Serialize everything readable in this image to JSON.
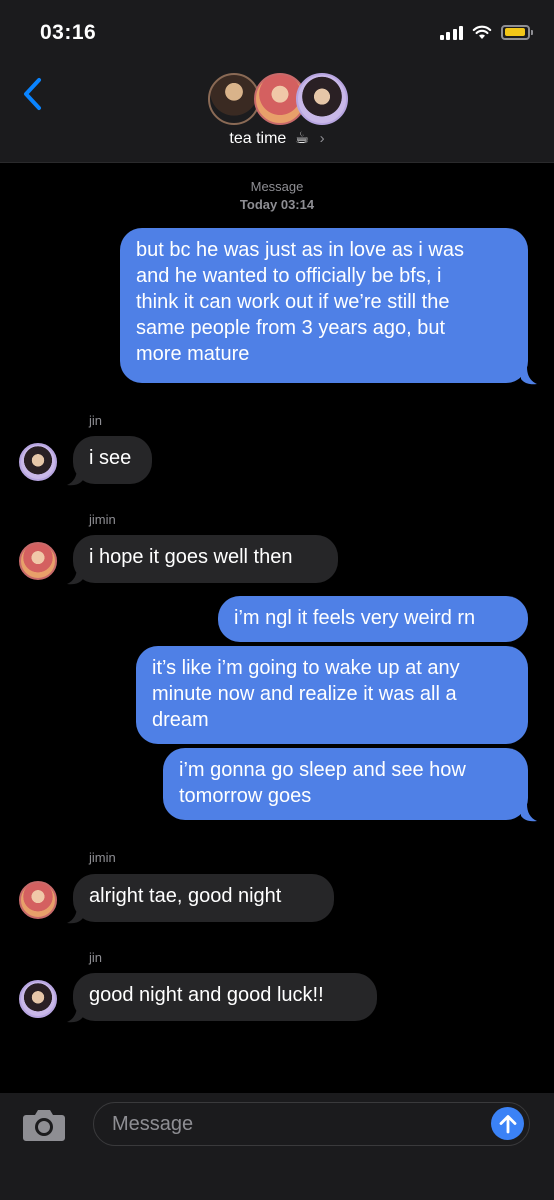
{
  "status_bar": {
    "time": "03:16",
    "battery_color": "#f2c618"
  },
  "header": {
    "group_name": "tea time",
    "group_emoji": "☕",
    "chevron": "›",
    "avatar_colors": [
      "#6b4a3a",
      "#c85a5a",
      "#7a6aa8"
    ]
  },
  "conversation": {
    "label": "Message",
    "time": "Today 03:14"
  },
  "messages": [
    {
      "from": "me",
      "lines": [
        "but bc he was just as in love as i was",
        "and he wanted to officially be bfs, i",
        "think it can work out if we’re still the",
        "same people from 3 years ago, but",
        "more mature"
      ]
    },
    {
      "from": "jin",
      "sender": "jin",
      "text": "i see"
    },
    {
      "from": "jimin",
      "sender": "jimin",
      "text": "i hope it goes well then"
    },
    {
      "from": "me",
      "text": "i’m ngl it feels very weird rn"
    },
    {
      "from": "me",
      "lines": [
        "it’s like i’m going to wake up at any",
        "minute now and realize it was all a",
        "dream"
      ]
    },
    {
      "from": "me",
      "lines": [
        "i’m gonna go sleep and see how",
        "tomorrow goes"
      ]
    },
    {
      "from": "jimin",
      "sender": "jimin",
      "text": "alright tae, good night"
    },
    {
      "from": "jin",
      "sender": "jin",
      "text": "good night and good luck!!"
    }
  ],
  "input": {
    "placeholder": "Message"
  },
  "colors": {
    "outgoing_bubble": "#4f80e6",
    "incoming_bubble": "#262628",
    "send_button": "#3b82f6",
    "accent": "#0a84ff"
  }
}
